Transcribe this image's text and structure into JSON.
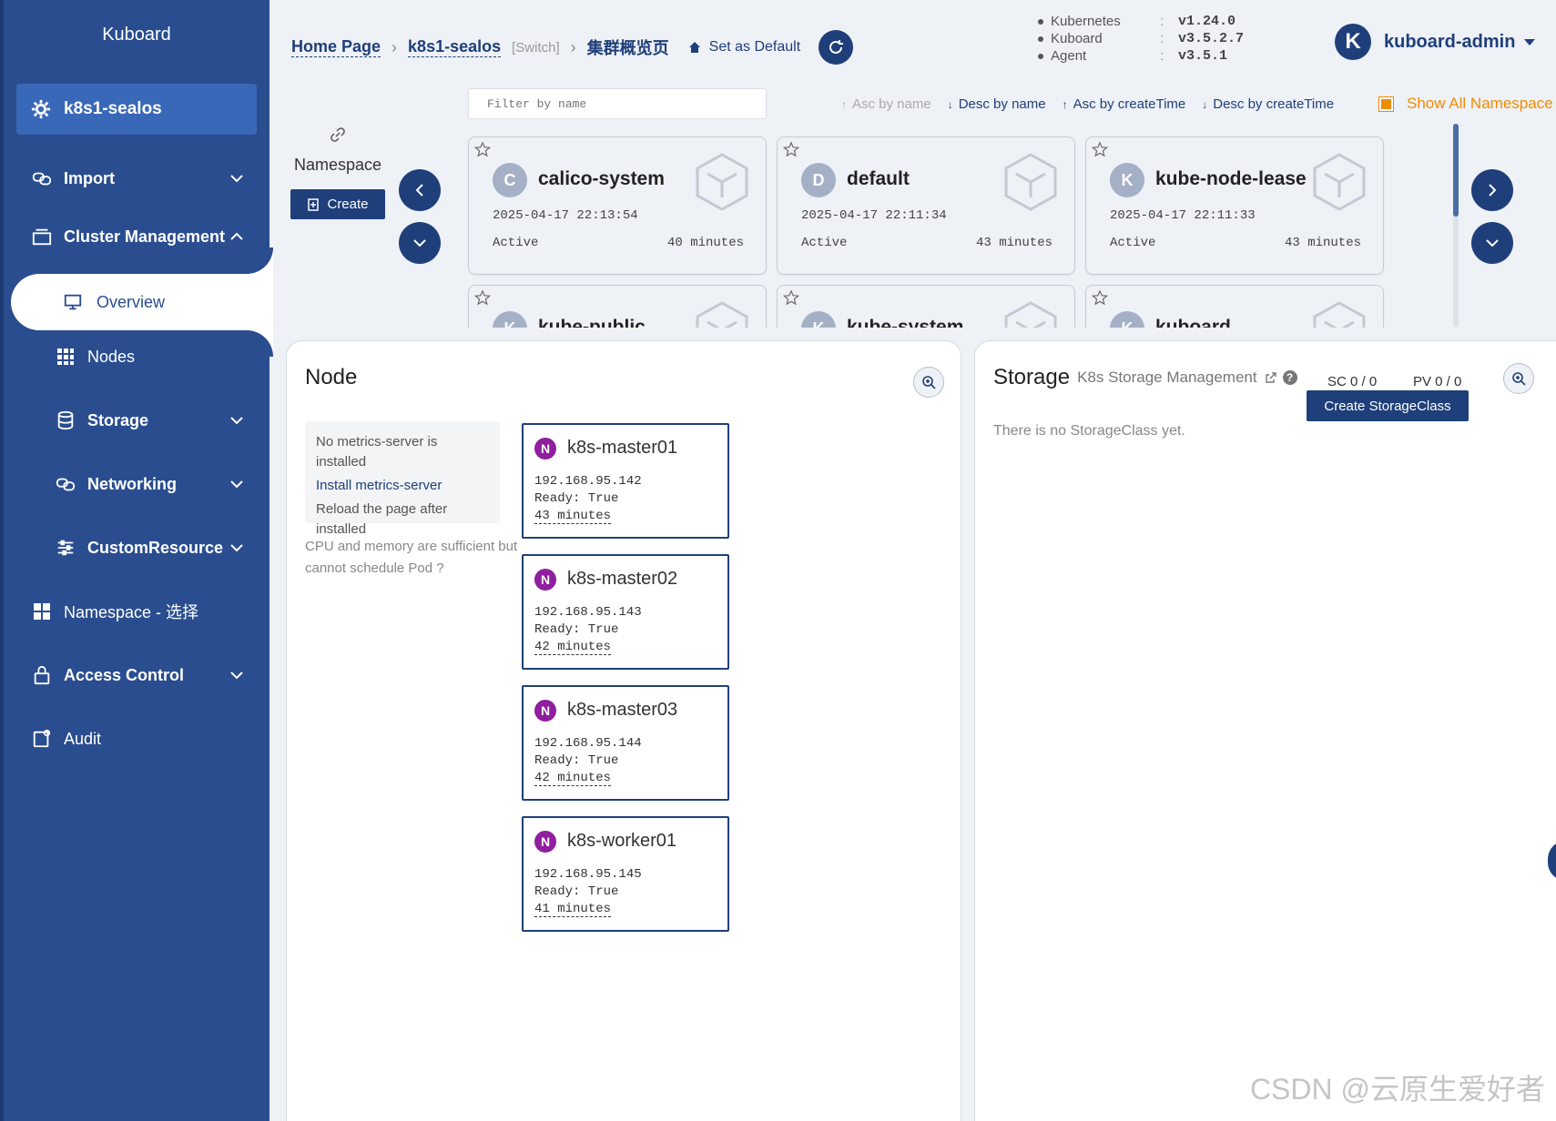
{
  "sidebar": {
    "brand": "Kuboard",
    "cluster": "k8s1-sealos",
    "items": [
      {
        "label": "Import"
      },
      {
        "label": "Cluster Management"
      },
      {
        "label": "Overview"
      },
      {
        "label": "Nodes"
      },
      {
        "label": "Storage"
      },
      {
        "label": "Networking"
      },
      {
        "label": "CustomResource"
      },
      {
        "label": "Namespace - 选择"
      },
      {
        "label": "Access Control"
      },
      {
        "label": "Audit"
      }
    ]
  },
  "header": {
    "home": "Home Page",
    "cluster": "k8s1-sealos",
    "switch": "[Switch]",
    "current": "集群概览页",
    "set_default": "Set as Default",
    "versions": [
      {
        "name": "Kubernetes",
        "value": "v1.24.0"
      },
      {
        "name": "Kuboard",
        "value": "v3.5.2.7"
      },
      {
        "name": "Agent",
        "value": "v3.5.1"
      }
    ],
    "avatar_letter": "K",
    "user": "kuboard-admin"
  },
  "namespace": {
    "title": "Namespace",
    "create_label": "Create",
    "filter_placeholder": "Filter by name",
    "sorts": [
      "Asc by name",
      "Desc by name",
      "Asc by createTime",
      "Desc by createTime"
    ],
    "show_all": "Show All Namespace",
    "cards": [
      {
        "letter": "C",
        "name": "calico-system",
        "created": "2025-04-17 22:13:54",
        "status": "Active",
        "age": "40 minutes"
      },
      {
        "letter": "D",
        "name": "default",
        "created": "2025-04-17 22:11:34",
        "status": "Active",
        "age": "43 minutes"
      },
      {
        "letter": "K",
        "name": "kube-node-lease",
        "created": "2025-04-17 22:11:33",
        "status": "Active",
        "age": "43 minutes"
      },
      {
        "letter": "K",
        "name": "kube-public",
        "created": "",
        "status": "",
        "age": ""
      },
      {
        "letter": "K",
        "name": "kube-system",
        "created": "",
        "status": "",
        "age": ""
      },
      {
        "letter": "K",
        "name": "kuboard",
        "created": "",
        "status": "",
        "age": ""
      }
    ]
  },
  "node_panel": {
    "title": "Node",
    "metrics_line1": "No metrics-server is installed",
    "metrics_link": "Install metrics-server",
    "metrics_line2": "Reload the page after installed",
    "cpu_note": "CPU and memory are sufficient but cannot schedule Pod ?",
    "nodes": [
      {
        "badge": "N",
        "name": "k8s-master01",
        "ip": "192.168.95.142",
        "ready": "Ready: True",
        "age": "43 minutes"
      },
      {
        "badge": "N",
        "name": "k8s-master02",
        "ip": "192.168.95.143",
        "ready": "Ready: True",
        "age": "42 minutes"
      },
      {
        "badge": "N",
        "name": "k8s-master03",
        "ip": "192.168.95.144",
        "ready": "Ready: True",
        "age": "42 minutes"
      },
      {
        "badge": "N",
        "name": "k8s-worker01",
        "ip": "192.168.95.145",
        "ready": "Ready: True",
        "age": "41 minutes"
      }
    ]
  },
  "storage_panel": {
    "title": "Storage",
    "subtitle": "K8s Storage Management",
    "help": "?",
    "sc": "SC 0 / 0",
    "pv": "PV 0 / 0",
    "create_label": "Create StorageClass",
    "empty": "There is no StorageClass yet."
  },
  "watermark": "CSDN @云原生爱好者"
}
